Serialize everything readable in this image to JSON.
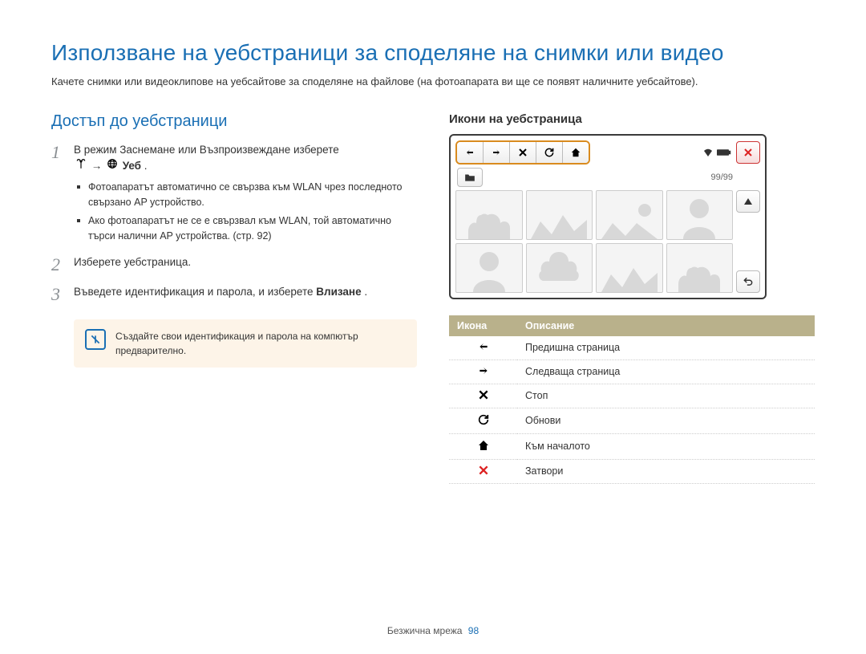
{
  "title": "Използване на уебстраници за споделяне на снимки или видео",
  "intro": "Качете снимки или видеоклипове на уебсайтове за споделяне на файлове (на фотоапарата ви ще се появят наличните уебсайтове).",
  "left": {
    "section_title": "Достъп до уебстраници",
    "steps": {
      "1": {
        "text_a": "В режим Заснемане или Възпроизвеждане изберете",
        "web_label": "Уеб",
        "dot": ".",
        "bullets": [
          "Фотоапаратът автоматично се свързва към WLAN чрез последното свързано AP устройство.",
          "Ако фотоапаратът не се е свързвал към WLAN, той автоматично търси налични AP устройства. (стр. 92)"
        ]
      },
      "2": {
        "text": "Изберете уебстраница."
      },
      "3": {
        "text_a": "Въведете идентификация и парола, и изберете",
        "bold": "Влизане",
        "dot": "."
      }
    },
    "note": "Създайте свои идентификация и парола на компютър предварително."
  },
  "right": {
    "sub_title": "Икони на уебстраница",
    "counter": "99/99",
    "table": {
      "head_icon": "Икона",
      "head_desc": "Описание",
      "rows": [
        {
          "icon": "arrow-left",
          "desc": "Предишна страница"
        },
        {
          "icon": "arrow-right",
          "desc": "Следваща страница"
        },
        {
          "icon": "x",
          "desc": "Стоп"
        },
        {
          "icon": "refresh",
          "desc": "Обнови"
        },
        {
          "icon": "home",
          "desc": "Към началото"
        },
        {
          "icon": "x-red",
          "desc": "Затвори"
        }
      ]
    }
  },
  "footer": {
    "label": "Безжична мрежа",
    "page": "98"
  }
}
